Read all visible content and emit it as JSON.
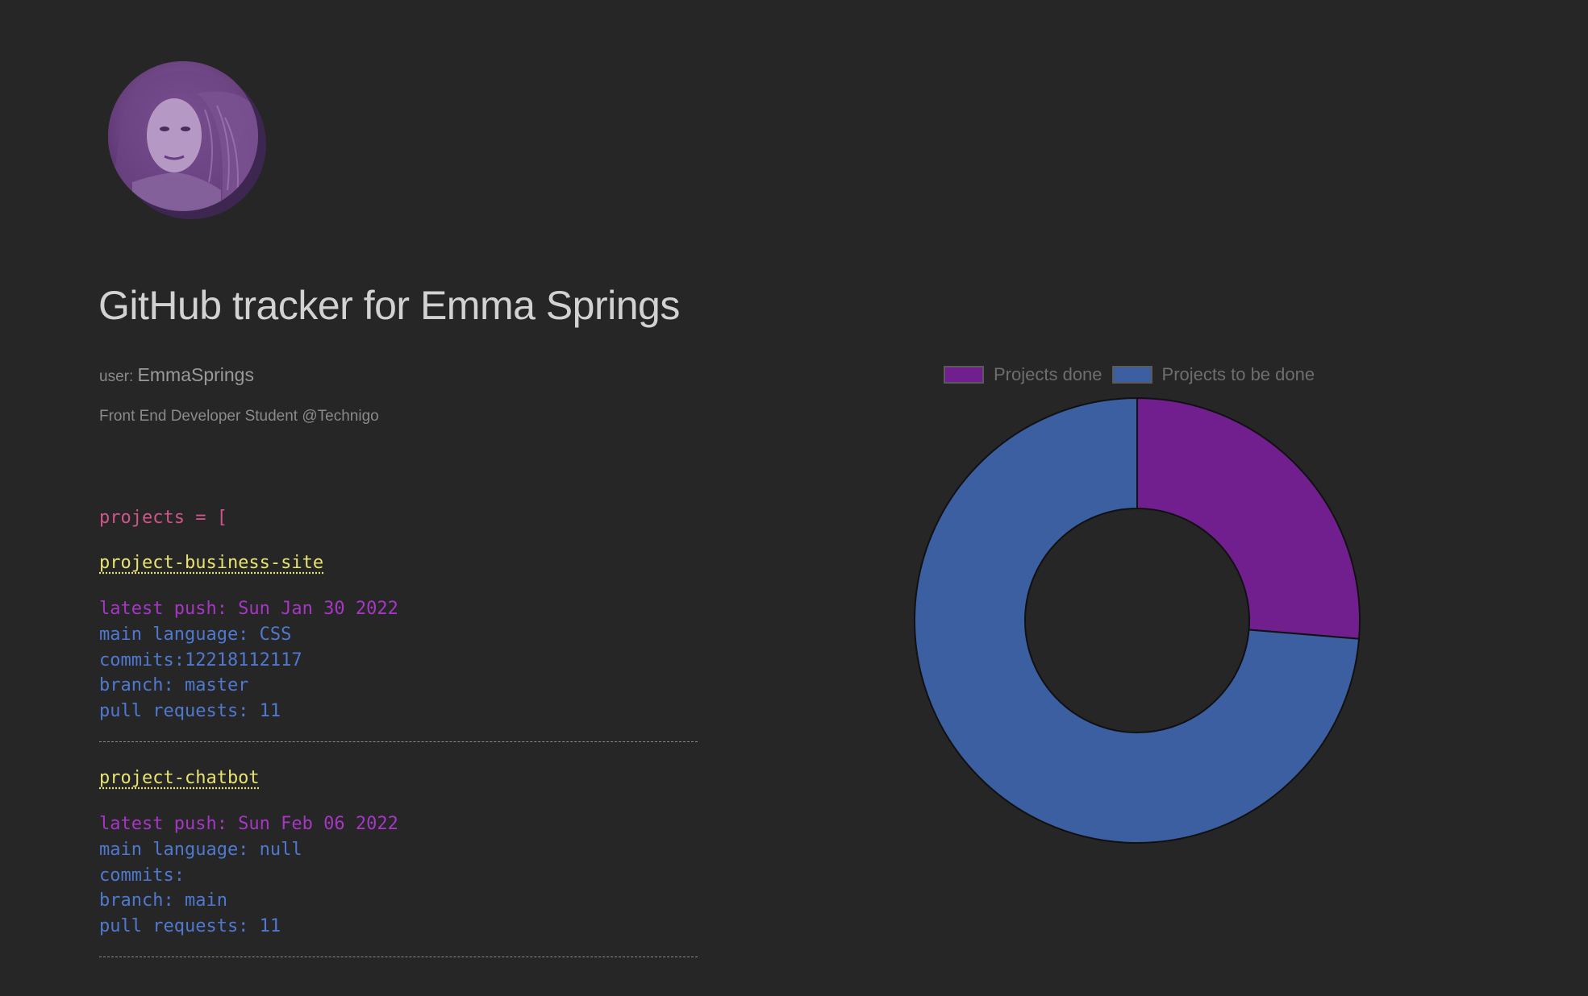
{
  "profile": {
    "avatar_alt": "Emma Springs profile photo",
    "title": "GitHub tracker for Emma Springs",
    "user_label": "user:",
    "username": "EmmaSprings",
    "bio": "Front End Developer Student @Technigo"
  },
  "projects": {
    "open_text": "projects = [",
    "items": [
      {
        "name": "project-business-site",
        "latest_push": "latest push: Sun Jan 30 2022",
        "main_language": "main language: CSS",
        "commits": "commits:12218112117",
        "branch": "branch: master",
        "pull_requests": "pull requests: 11"
      },
      {
        "name": "project-chatbot",
        "latest_push": "latest push: Sun Feb 06 2022",
        "main_language": "main language: null",
        "commits": "commits:",
        "branch": "branch: main",
        "pull_requests": "pull requests: 11"
      }
    ]
  },
  "chart_data": {
    "type": "pie",
    "variant": "doughnut",
    "categories": [
      "Projects done",
      "Projects to be done"
    ],
    "values": [
      5,
      14
    ],
    "colors": [
      "#711f8f",
      "#3b5fa0"
    ],
    "legend_position": "top",
    "title": ""
  },
  "colors": {
    "background": "#262626",
    "projects_bracket": "#d1548a",
    "project_link": "#e8e36f",
    "latest_push": "#a637c4",
    "meta_text": "#4f79cf"
  }
}
